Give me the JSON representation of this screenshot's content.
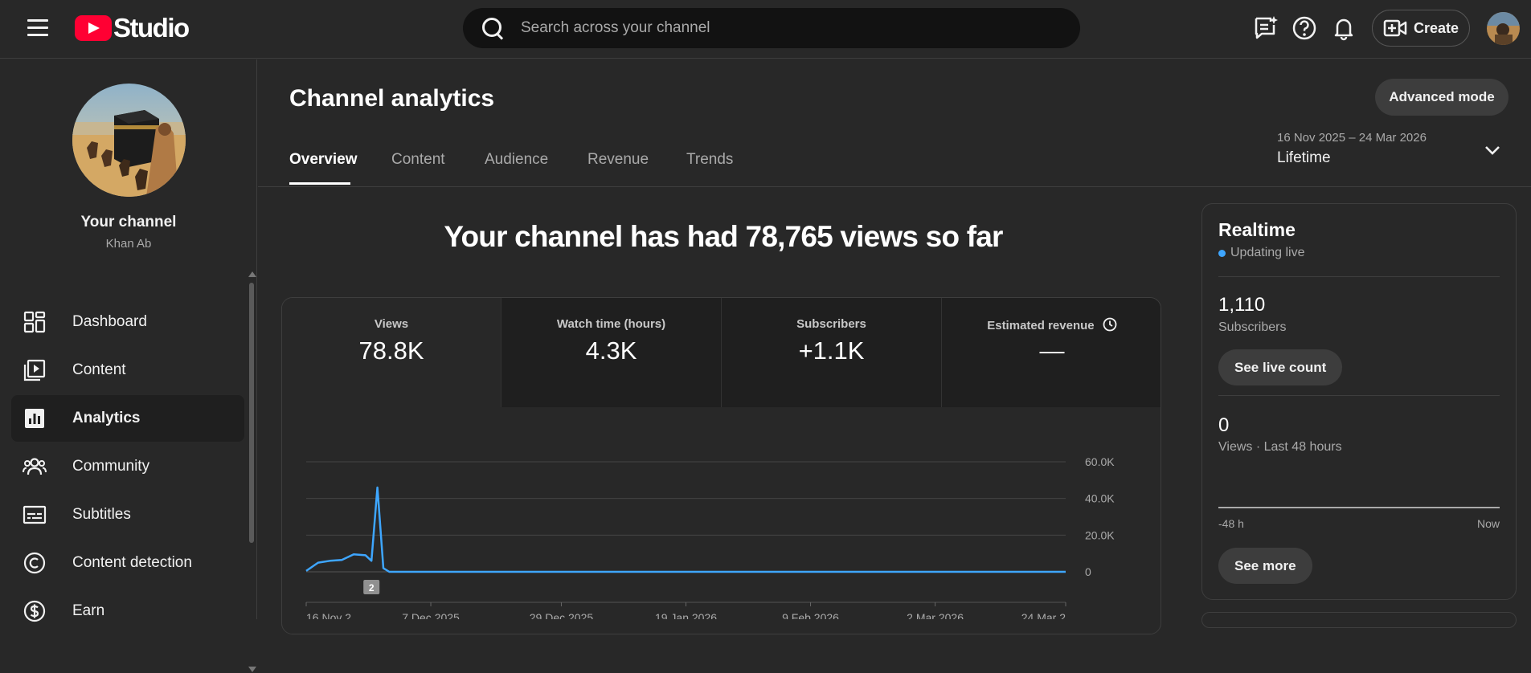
{
  "app": {
    "logo_text": "Studio"
  },
  "search": {
    "placeholder": "Search across your channel"
  },
  "header": {
    "create_label": "Create"
  },
  "channel": {
    "title": "Your channel",
    "name": "Khan Ab"
  },
  "sidebar": {
    "items": [
      {
        "label": "Dashboard",
        "icon": "dashboard-icon"
      },
      {
        "label": "Content",
        "icon": "content-icon"
      },
      {
        "label": "Analytics",
        "icon": "analytics-icon",
        "active": true
      },
      {
        "label": "Community",
        "icon": "community-icon"
      },
      {
        "label": "Subtitles",
        "icon": "subtitles-icon"
      },
      {
        "label": "Content detection",
        "icon": "copyright-icon"
      },
      {
        "label": "Earn",
        "icon": "dollar-icon"
      }
    ]
  },
  "page": {
    "title": "Channel analytics",
    "advanced_label": "Advanced mode",
    "tabs": [
      "Overview",
      "Content",
      "Audience",
      "Revenue",
      "Trends"
    ],
    "date_range": "16 Nov 2025 – 24 Mar 2026",
    "date_label": "Lifetime",
    "headline": "Your channel has had 78,765 views so far"
  },
  "metrics": [
    {
      "label": "Views",
      "value": "78.8K"
    },
    {
      "label": "Watch time (hours)",
      "value": "4.3K"
    },
    {
      "label": "Subscribers",
      "value": "+1.1K"
    },
    {
      "label": "Estimated revenue",
      "value": "—"
    }
  ],
  "chart_data": {
    "type": "line",
    "x": [
      "16 Nov 2025",
      "18 Nov 2025",
      "20 Nov 2025",
      "22 Nov 2025",
      "24 Nov 2025",
      "26 Nov 2025",
      "27 Nov 2025",
      "28 Nov 2025",
      "29 Nov 2025",
      "30 Nov 2025",
      "7 Dec 2025",
      "29 Dec 2025",
      "19 Jan 2026",
      "9 Feb 2026",
      "2 Mar 2026",
      "24 Mar 2026"
    ],
    "series": [
      {
        "values": [
          500,
          5000,
          6000,
          6500,
          9500,
          9000,
          6000,
          46000,
          2000,
          0,
          0,
          0,
          0,
          0,
          0,
          0
        ]
      }
    ],
    "y_ticks": [
      "60.0K",
      "40.0K",
      "20.0K",
      "0"
    ],
    "x_tick_labels": [
      "16 Nov 2",
      "7 Dec 2025",
      "29 Dec 2025",
      "19 Jan 2026",
      "9 Feb 2026",
      "2 Mar 2026",
      "24 Mar 2"
    ],
    "ylim": [
      0,
      60000
    ],
    "marker_label": "2",
    "line_color": "#3ea6ff",
    "grid": true
  },
  "realtime": {
    "title": "Realtime",
    "live_label": "Updating live",
    "subscribers_value": "1,110",
    "subscribers_label": "Subscribers",
    "see_live_label": "See live count",
    "views_value": "0",
    "views_label": "Views · Last 48 hours",
    "axis_left": "-48 h",
    "axis_right": "Now",
    "see_more_label": "See more"
  }
}
